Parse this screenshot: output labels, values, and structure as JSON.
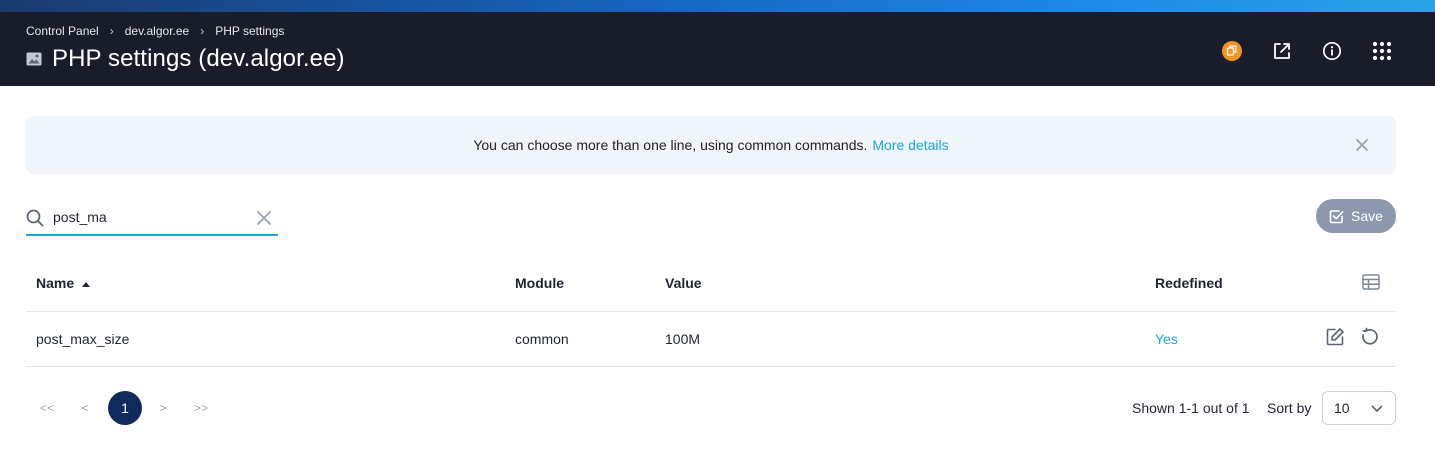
{
  "breadcrumb": {
    "items": [
      "Control Panel",
      "dev.algor.ee",
      "PHP settings"
    ],
    "separator": "›"
  },
  "page_title": "PHP settings (dev.algor.ee)",
  "header_icons": [
    "notification-icon",
    "external-link-icon",
    "info-icon",
    "apps-grid-icon"
  ],
  "notice": {
    "text": "You can choose more than one line, using common commands.",
    "link": "More details"
  },
  "search": {
    "value": "post_ma",
    "placeholder": ""
  },
  "toolbar": {
    "save_label": "Save"
  },
  "table": {
    "columns": [
      "Name",
      "Module",
      "Value",
      "Redefined"
    ],
    "sort_column": "Name",
    "sort_direction": "ascending",
    "rows": [
      {
        "name": "post_max_size",
        "module": "common",
        "value": "100M",
        "redefined": "Yes"
      }
    ]
  },
  "pagination": {
    "first": "<<",
    "prev": "<",
    "current": "1",
    "next": ">",
    "last": ">>",
    "shown": "Shown 1-1 out of 1",
    "sort_by_label": "Sort by",
    "page_size": "10"
  },
  "colors": {
    "header_bg": "#181d29",
    "accent": "#1aa6d6",
    "notification": "#f29324",
    "page_current": "#0f2a5c",
    "save_button": "#8d97ad"
  }
}
